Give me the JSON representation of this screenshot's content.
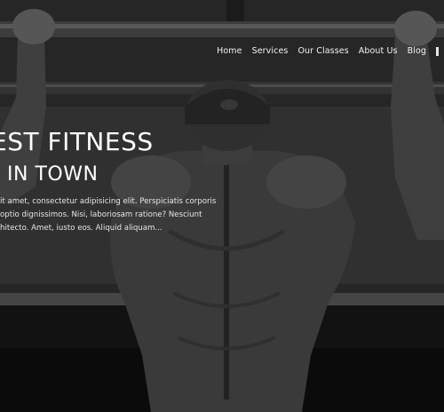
{
  "nav": {
    "items": [
      {
        "label": "Home"
      },
      {
        "label": "Services"
      },
      {
        "label": "Our Classes"
      },
      {
        "label": "About Us"
      },
      {
        "label": "Blog"
      }
    ]
  },
  "hero": {
    "headline": "EST FITNESS",
    "subheadline": "IN TOWN",
    "body_lines": [
      "it amet, consectetur adipisicing elit. Perspiciatis corporis",
      "optio dignissimos. Nisi, laboriosam ratione? Nesciunt",
      "hitecto. Amet, iusto eos. Aliquid aliquam..."
    ]
  },
  "colors": {
    "overlay": "#2c2c2c",
    "text": "#ffffff"
  }
}
